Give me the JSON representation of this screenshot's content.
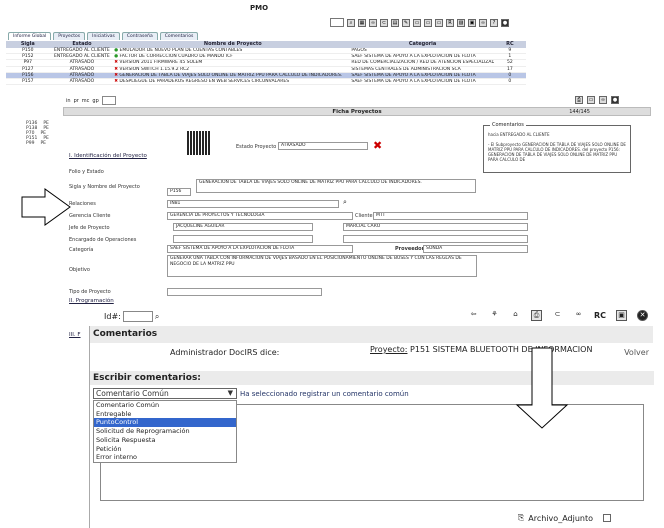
{
  "app_title": "PMO",
  "tabs": [
    "Informe Global",
    "Proyectos",
    "Iniciativas",
    "Contraseña",
    "Comentarios"
  ],
  "grid": {
    "headers": [
      "Sigla",
      "Estado",
      "Nombre de Proyecto",
      "Categoria",
      "RC"
    ],
    "rows": [
      {
        "sigla": "P150",
        "estado": "ENTREGADO AL CLIENTE",
        "status": "ok",
        "nombre": "EMULADOR DE NUEVO PLAN DE CUENTAS CONTABLES",
        "categoria": "PAGOS",
        "rc": "9"
      },
      {
        "sigla": "P152",
        "estado": "ENTREGADO AL CLIENTE",
        "status": "ok",
        "nombre": "FACTOR DE CORRECCION CUADRO DE MANDO ICF",
        "categoria": "SAEF SISTEMA DE APOYO A LA EXPLOTACION DE FLOTA",
        "rc": "1"
      },
      {
        "sigla": "P97",
        "estado": "ATRASADO",
        "status": "x",
        "nombre": "VERSION 2011 FIRMWARE 45 SOLEM",
        "categoria": "RED DE COMERCIALIZACION / RED DE ATENCION ESPECIALIZADA",
        "rc": "52"
      },
      {
        "sigla": "P127",
        "estado": "ATRASADO",
        "status": "x",
        "nombre": "VERSION SWITCH 1.15.9.2 RC2",
        "categoria": "SISTEMAS CENTRALES DE ADMINISTRACION SCA",
        "rc": "17"
      },
      {
        "sigla": "P156",
        "estado": "ATRASADO",
        "status": "x",
        "nombre": "GENERACION DE TABLA DE VIAJES SOLO ONLINE DE MATRIZ PPU PARA CALCULO DE INDICADORES.",
        "categoria": "SAEF SISTEMA DE APOYO A LA EXPLOTACION DE FLOTA",
        "rc": "0"
      },
      {
        "sigla": "P157",
        "estado": "ATRASADO",
        "status": "x",
        "nombre": "DESPLIEGUE DE PARADEROS REGRESO EN WEB SERVICES CIRCUNVALARES",
        "categoria": "SAEF SISTEMA DE APOYO A LA EXPLOTACION DE FLOTA",
        "rc": "0"
      }
    ],
    "more_ids": [
      "P136",
      "P138",
      "P70",
      "P151",
      "P99"
    ],
    "more_ids_tail": [
      "PE",
      "PE",
      "PE",
      "PE",
      "PE"
    ]
  },
  "ficha_toolbar": [
    "in",
    "pr",
    "mc",
    "gp"
  ],
  "ficha": {
    "title": "Ficha Proyectos",
    "count": "144/145",
    "section1": "I. Identificación del Proyecto",
    "estado_label": "Estado Proyecto",
    "estado_value": "ATRASADO",
    "comentarios_legend": "Comentarios",
    "comentarios_text": "hacia ENTREGADO AL CLIENTE\n\n- El Subproyecto GENERACION DE TABLA DE VIAJES SOLO ONLINE DE MATRIZ PPU PARA CALCULO DE INDICADORES. del proyecto P156: GENERACION DE TABLA DE VIAJES SOLO ONLINE DE MATRIZ PPU PARA CALCULO DE",
    "folio_label": "Folio y Estado",
    "sigla_label": "Sigla y Nombre del Proyecto",
    "nombre_value": "GENERACION DE TABLA DE VIAJES SOLO ONLINE DE MATRIZ PPU PARA CALCULO DE INDICADORES.",
    "sigla_value": "P156",
    "relaciones_label": "Relaciones",
    "relaciones_value": "IN81",
    "gerencia_label": "Gerencia Cliente",
    "gerencia_value": "GERENCIA DE PROYECTOS Y TECNOLOGIA",
    "cliente_label": "Cliente",
    "cliente_value": "MTT",
    "jefe_label": "Jefe de Proyecto",
    "jefe_value": "JACQUELINE AGUILAR",
    "jefe_value2": "MARCIAL CARO",
    "encargado_label": "Encargado de Operaciones",
    "categoria_label": "Categoría",
    "categoria_value": "SAEF SISTEMA DE APOYO A LA EXPLOTACION DE FLOTA",
    "proveedor_label": "Proveedor",
    "proveedor_value": "SONDA",
    "objetivo_label": "Objetivo",
    "objetivo_value": "GENERAR UNA TABLA CON INFORMACION DE VIAJES BASADO EN EL POSICIONAMIENTO ONLINE DE BUSES Y CON LAS REGLAS DE NEGOCIO DE LA MATRIZ PPU",
    "tipo_label": "Tipo de Proyecto",
    "section2": "II. Programación",
    "section3": "III. F"
  },
  "id_search_label": "Id#:",
  "bottom_toolbar_rc": "RC",
  "dialog": {
    "title": "Comentarios",
    "admin_text": "Administrador DocIRS dice:",
    "project_label": "Proyecto:",
    "project_value": "P151 SISTEMA BLUETOOTH DE INFORMACION",
    "volver": "Volver",
    "subtitle": "Escribir comentarios:",
    "selected": "Comentario Común",
    "message": "Ha seleccionado registrar un comentario común",
    "options": [
      "Comentario Común",
      "Entregable",
      "PuntoControl",
      "Solicitud de Reprogramación",
      "Solicita Respuesta",
      "Petición",
      "Error interno"
    ],
    "highlighted_index": 2,
    "attachment_label": "Archivo_Adjunto"
  },
  "colors": {
    "accent": "#3366cc",
    "grid_header": "#c8cfe0",
    "selected_row": "#b9c6e6",
    "error": "#cc0000",
    "ok": "#2a9a2a"
  }
}
